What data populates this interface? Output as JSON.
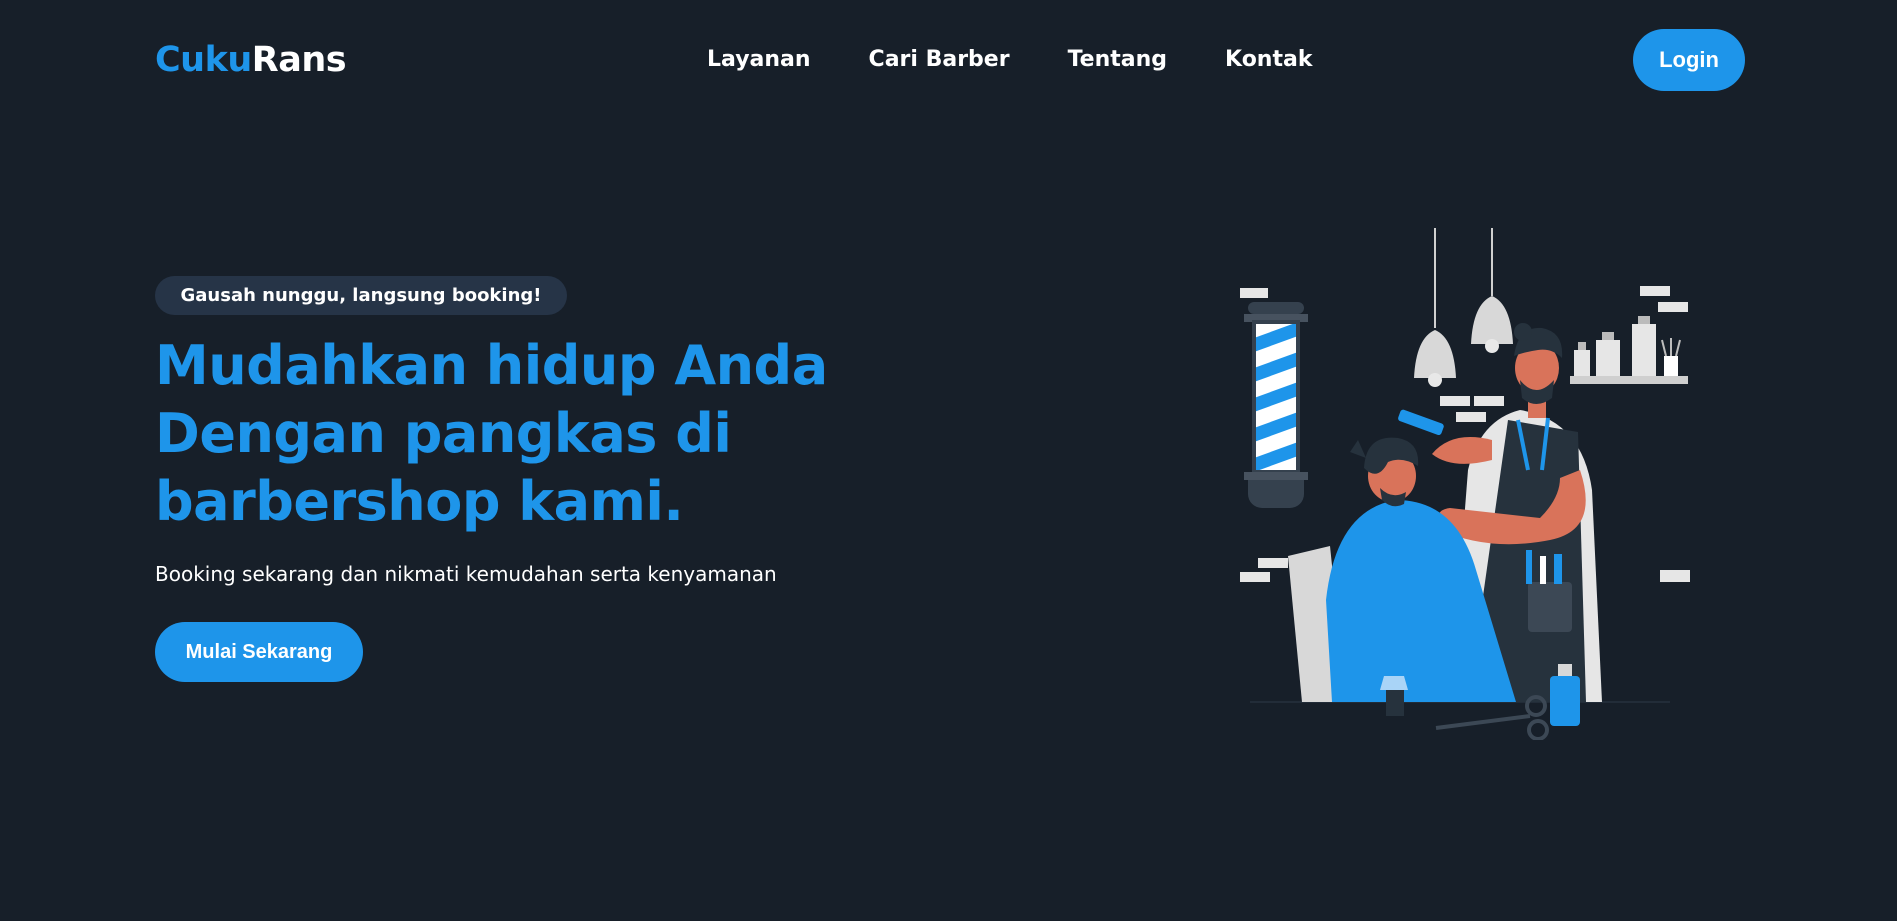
{
  "header": {
    "logo_part1": "Cuku",
    "logo_part2": "Rans",
    "nav": [
      {
        "label": "Layanan"
      },
      {
        "label": "Cari Barber"
      },
      {
        "label": "Tentang"
      },
      {
        "label": "Kontak"
      }
    ],
    "login_label": "Login"
  },
  "hero": {
    "badge": "Gausah nunggu, langsung booking!",
    "title_lines": [
      "Mudahkan hidup Anda",
      "Dengan pangkas di",
      "barbershop kami."
    ],
    "subtitle": "Booking sekarang dan nikmati kemudahan serta kenyamanan",
    "cta_label": "Mulai Sekarang"
  },
  "colors": {
    "background": "#171f29",
    "accent": "#1e95ea",
    "badge_bg": "#263447",
    "text": "#ffffff"
  },
  "illustration": {
    "icon": "barber-cutting-hair-illustration"
  }
}
